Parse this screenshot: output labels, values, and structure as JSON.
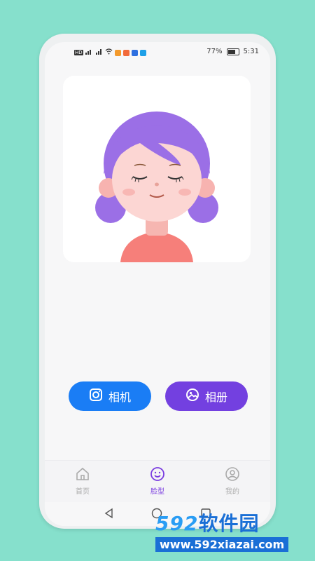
{
  "status_bar": {
    "battery_percent": "77%",
    "time": "5:31"
  },
  "actions": {
    "camera_label": "相机",
    "album_label": "相册"
  },
  "tabs": [
    {
      "label": "首页",
      "icon": "home-icon",
      "active": false
    },
    {
      "label": "脸型",
      "icon": "smiley-icon",
      "active": true
    },
    {
      "label": "我的",
      "icon": "user-icon",
      "active": false
    }
  ],
  "watermark": {
    "brand_number": "592",
    "brand_text": "软件园",
    "url": "www.592xiazai.com"
  },
  "colors": {
    "background": "#86e0cc",
    "camera_button": "#1a7df5",
    "album_button": "#7340e0",
    "active_tab": "#7a3ce0"
  }
}
